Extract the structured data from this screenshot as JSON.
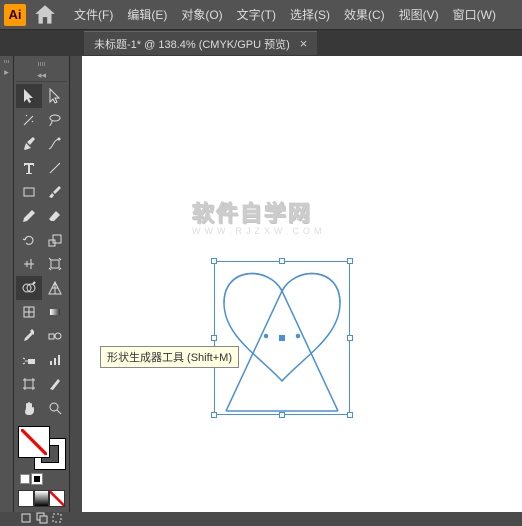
{
  "app": {
    "logo": "Ai"
  },
  "menu": {
    "file": "文件(F)",
    "edit": "编辑(E)",
    "object": "对象(O)",
    "type": "文字(T)",
    "select": "选择(S)",
    "effect": "效果(C)",
    "view": "视图(V)",
    "window": "窗口(W)"
  },
  "tab": {
    "title": "未标题-1* @ 138.4%  (CMYK/GPU 预览)",
    "close": "×"
  },
  "tooltip": {
    "text": "形状生成器工具 (Shift+M)"
  },
  "watermark": {
    "line1": "软件自学网",
    "line2": "WWW.RJZXW.COM"
  },
  "tools": [
    [
      "selection",
      "direct-selection"
    ],
    [
      "magic-wand",
      "lasso"
    ],
    [
      "pen",
      "curvature"
    ],
    [
      "type",
      "line-segment"
    ],
    [
      "rectangle",
      "paintbrush"
    ],
    [
      "pencil",
      "eraser"
    ],
    [
      "rotate",
      "scale"
    ],
    [
      "width",
      "free-transform"
    ],
    [
      "shape-builder",
      "perspective"
    ],
    [
      "mesh",
      "gradient"
    ],
    [
      "eyedropper",
      "blend"
    ],
    [
      "symbol-sprayer",
      "graph"
    ],
    [
      "artboard",
      "slice"
    ],
    [
      "hand",
      "zoom"
    ]
  ],
  "colors": {
    "accent": "#4a90d9",
    "app_orange": "#ff9a00",
    "tooltip_bg": "#ffffe1"
  }
}
